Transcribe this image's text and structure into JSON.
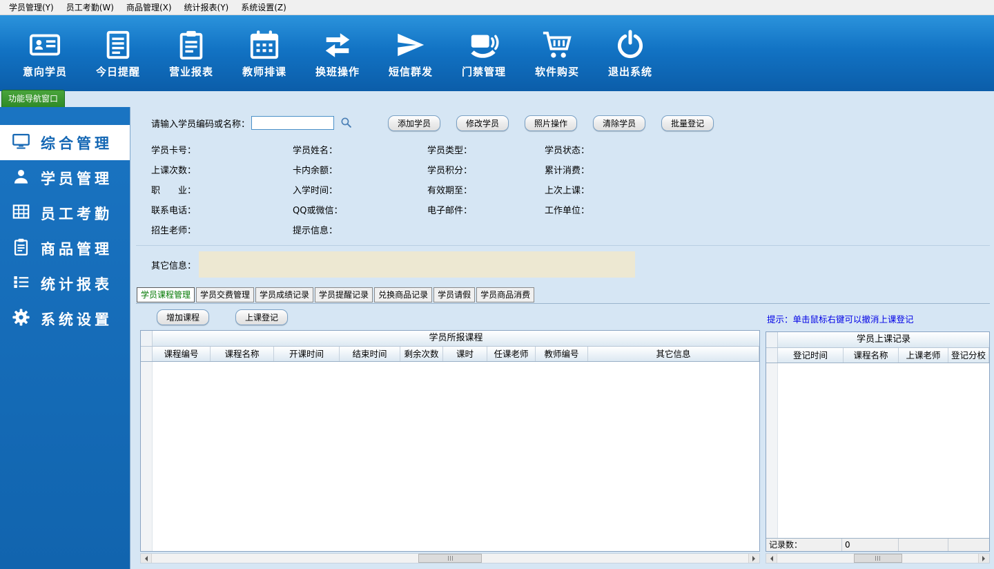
{
  "menubar": {
    "items": [
      {
        "label": "学员管理(Y)"
      },
      {
        "label": "员工考勤(W)"
      },
      {
        "label": "商品管理(X)"
      },
      {
        "label": "统计报表(Y)"
      },
      {
        "label": "系统设置(Z)"
      }
    ]
  },
  "toolbar": {
    "items": [
      {
        "label": "意向学员",
        "icon": "id-card-icon"
      },
      {
        "label": "今日提醒",
        "icon": "reminder-document-icon"
      },
      {
        "label": "营业报表",
        "icon": "clipboard-report-icon"
      },
      {
        "label": "教师排课",
        "icon": "calendar-icon"
      },
      {
        "label": "换班操作",
        "icon": "swap-arrows-icon"
      },
      {
        "label": "短信群发",
        "icon": "send-message-icon"
      },
      {
        "label": "门禁管理",
        "icon": "access-card-icon"
      },
      {
        "label": "软件购买",
        "icon": "shopping-cart-icon"
      },
      {
        "label": "退出系统",
        "icon": "power-icon"
      }
    ]
  },
  "nav": {
    "header": "功能导航窗口",
    "items": [
      {
        "label": "综合管理",
        "icon": "monitor-icon",
        "active": true
      },
      {
        "label": "学员管理",
        "icon": "user-icon",
        "active": false
      },
      {
        "label": "员工考勤",
        "icon": "grid-table-icon",
        "active": false
      },
      {
        "label": "商品管理",
        "icon": "clipboard-icon",
        "active": false
      },
      {
        "label": "统计报表",
        "icon": "list-report-icon",
        "active": false
      },
      {
        "label": "系统设置",
        "icon": "gear-icon",
        "active": false
      }
    ]
  },
  "search": {
    "label": "请输入学员编码或名称：",
    "value": "",
    "icon": "search-icon",
    "buttons": [
      {
        "label": "添加学员"
      },
      {
        "label": "修改学员"
      },
      {
        "label": "照片操作"
      },
      {
        "label": "清除学员"
      },
      {
        "label": "批量登记"
      }
    ]
  },
  "info": {
    "fields": [
      "学员卡号：",
      "学员姓名：",
      "学员类型：",
      "学员状态：",
      "上课次数：",
      "卡内余额：",
      "学员积分：",
      "累计消费：",
      "职　　业：",
      "入学时间：",
      "有效期至：",
      "上次上课：",
      "联系电话：",
      "QQ或微信：",
      "电子邮件：",
      "工作单位：",
      "招生老师：",
      "提示信息："
    ],
    "other_label": "其它信息：",
    "other_value": ""
  },
  "tabs": {
    "items": [
      {
        "label": "学员课程管理",
        "active": true
      },
      {
        "label": "学员交费管理",
        "active": false
      },
      {
        "label": "学员成绩记录",
        "active": false
      },
      {
        "label": "学员提醒记录",
        "active": false
      },
      {
        "label": "兑换商品记录",
        "active": false
      },
      {
        "label": "学员请假",
        "active": false
      },
      {
        "label": "学员商品消费",
        "active": false
      }
    ]
  },
  "courses": {
    "buttons": [
      {
        "label": "增加课程"
      },
      {
        "label": "上课登记"
      }
    ],
    "table_title": "学员所报课程",
    "columns": [
      "课程编号",
      "课程名称",
      "开课时间",
      "结束时间",
      "剩余次数",
      "课时",
      "任课老师",
      "教师编号",
      "其它信息"
    ],
    "rows": []
  },
  "records": {
    "hint": "提示：单击鼠标右键可以撤消上课登记",
    "table_title": "学员上课记录",
    "columns": [
      "登记时间",
      "课程名称",
      "上课老师",
      "登记分校"
    ],
    "rows": [],
    "footer_label": "记录数：",
    "footer_value": "0"
  },
  "colors": {
    "toolbar_blue": "#1273c4",
    "sidebar_blue": "#1269b5",
    "active_item_text": "#1467b4",
    "nav_tab_green": "#2f8a27",
    "hint_blue": "#0000e6",
    "tab_active_green": "#007800",
    "other_box_beige": "#ede8d2"
  }
}
